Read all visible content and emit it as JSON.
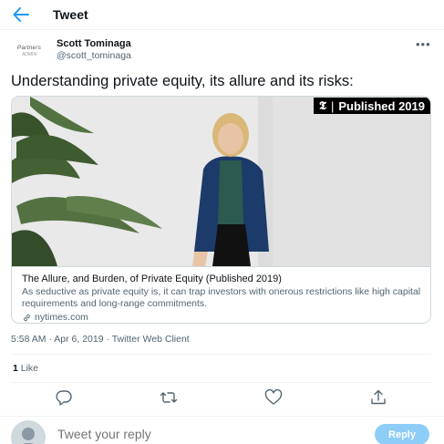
{
  "header": {
    "title": "Tweet"
  },
  "author": {
    "avatar_line1": "Partners",
    "avatar_line2": "ADMIN",
    "name": "Scott Tominaga",
    "handle": "@scott_tominaga"
  },
  "tweet": {
    "text": "Understanding private equity, its allure and its risks:",
    "timestamp": "5:58 AM · Apr 6, 2019 · Twitter Web Client",
    "like_count": "1",
    "like_label": " Like"
  },
  "card": {
    "badge_logo": "𝕿",
    "badge_text": "Published 2019",
    "title": "The Allure, and Burden, of Private Equity (Published 2019)",
    "description": "As seductive as private equity is, it can trap investors with onerous restrictions like high capital requirements and long-range commitments.",
    "domain": "nytimes.com"
  },
  "reply": {
    "placeholder": "Tweet your reply",
    "button_label": "Reply"
  },
  "colors": {
    "accent": "#1d9bf0",
    "reply_button_disabled": "#8ecdf8",
    "secondary_text": "#536471"
  },
  "icons": [
    "back-arrow-icon",
    "more-icon",
    "link-icon",
    "reply-icon",
    "retweet-icon",
    "like-icon",
    "share-icon"
  ]
}
